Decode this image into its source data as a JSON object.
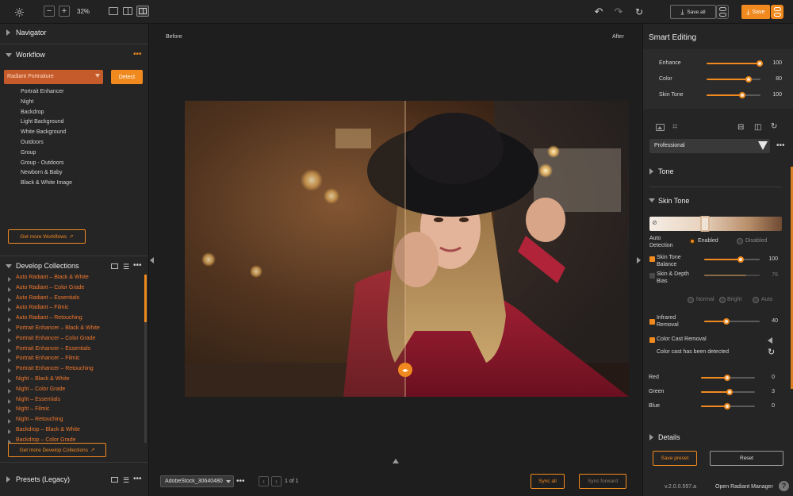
{
  "toolbar": {
    "zoom": "32%",
    "minus": "−",
    "plus": "+",
    "save_all": "Save all",
    "save": "Save"
  },
  "left": {
    "navigator": "Navigator",
    "workflow": "Workflow",
    "workflow_select": "Radiant Portraiture",
    "detect": "Detect",
    "workflow_items": [
      "Portrait Enhancer",
      "Night",
      "Backdrop",
      "Light Background",
      "White Background",
      "Outdoors",
      "Group",
      "Group - Outdoors",
      "Newborn & Baby",
      "Black & White Image"
    ],
    "get_more_workflows": "Get more Workflows",
    "develop_collections": "Develop Collections",
    "collections": [
      "Auto Radiant – Black & White",
      "Auto Radiant – Color Grade",
      "Auto Radiant – Essentials",
      "Auto Radiant – Filmic",
      "Auto Radiant – Retouching",
      "Portrait Enhancer – Black & White",
      "Portrait Enhancer – Color Grade",
      "Portrait Enhancer – Essentials",
      "Portrait Enhancer – Filmic",
      "Portrait Enhancer – Retouching",
      "Night – Black & White",
      "Night – Color Grade",
      "Night – Essentials",
      "Night – Filmic",
      "Night – Retouching",
      "Backdrop – Black & White",
      "Backdrop – Color Grade"
    ],
    "get_more_collections": "Get more Develop Collections",
    "presets": "Presets (Legacy)"
  },
  "center": {
    "before": "Before",
    "after": "After",
    "filename": "AdobeStock_30640480",
    "page_info": "1 of 1",
    "sync_all": "Sync all",
    "sync_forward": "Sync forward"
  },
  "right": {
    "title": "Smart Editing",
    "smart_sliders": [
      {
        "label": "Enhance",
        "value": "100",
        "level": 1.0
      },
      {
        "label": "Color",
        "value": "80",
        "level": 0.8
      },
      {
        "label": "Skin Tone",
        "value": "100",
        "level": 0.67
      }
    ],
    "preset_select": "Professional",
    "tone": "Tone",
    "skin_tone": "Skin Tone",
    "auto_detection": "Auto Detection",
    "enabled": "Enabled",
    "disabled": "Disabled",
    "skin_tone_balance": "Skin Tone Balance",
    "skin_tone_balance_value": "100",
    "skin_depth_bias": "Skin & Depth Bias",
    "skin_depth_bias_value": "76",
    "normal": "Normal",
    "bright": "Bright",
    "auto": "Auto",
    "infrared_removal": "Infrared Removal",
    "infrared_value": "40",
    "color_cast_removal": "Color Cast Removal",
    "color_cast_detected": "Color cast has been detected",
    "rgb": [
      {
        "label": "Red",
        "value": "0",
        "level": 0.5
      },
      {
        "label": "Green",
        "value": "3",
        "level": 0.55
      },
      {
        "label": "Blue",
        "value": "0",
        "level": 0.5
      }
    ],
    "details": "Details",
    "save_preset": "Save preset",
    "reset": "Reset",
    "version": "v.2.0.0.597.a",
    "open_manager": "Open Radiant Manager",
    "help": "?"
  },
  "colors": {
    "accent": "#f08a1f",
    "collection_text": "#f0782d",
    "panel": "#262525",
    "background": "#1f1e1e"
  }
}
